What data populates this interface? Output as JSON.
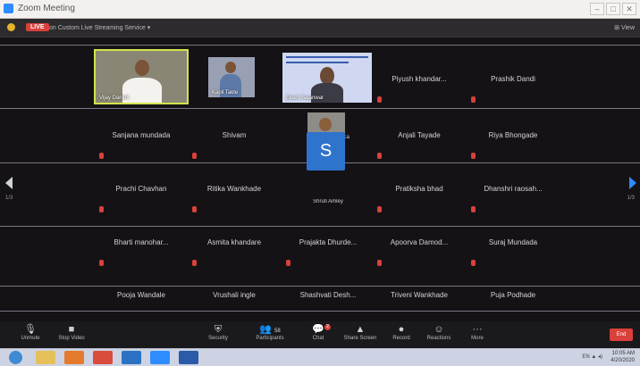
{
  "window": {
    "title": "Zoom Meeting",
    "controls": [
      "–",
      "□",
      "✕"
    ]
  },
  "meeting_bar": {
    "live_label": "LIVE",
    "topic": "on Custom Live Streaming Service ▾",
    "view_label": "⊞ View"
  },
  "rows": [
    [
      {
        "name": "Vijay Dankhl",
        "video": true
      },
      {
        "name": "Kapil Takte",
        "video": true
      },
      {
        "name": "Ekant Sajanwar",
        "video": true
      },
      {
        "name": "Piyush  khandar..."
      },
      {
        "name": "Prashik Dandi"
      }
    ],
    [
      {
        "name": "Sanjana mundada"
      },
      {
        "name": "Shivam"
      },
      {
        "name": "Crishnadhurati Ka",
        "video": true
      },
      {
        "name": "Anjali Tayade"
      },
      {
        "name": "Riya Bhongade"
      }
    ],
    [
      {
        "name": "Prachi Chavhan"
      },
      {
        "name": "Ritika Wankhade"
      },
      {
        "name": "Shruti Amley",
        "avatar": "S"
      },
      {
        "name": "Pratiksha bhad"
      },
      {
        "name": "Dhanshri  raosah..."
      }
    ],
    [
      {
        "name": "Bharti  manohar..."
      },
      {
        "name": "Asmita khandare"
      },
      {
        "name": "Prajakta  Dhurde..."
      },
      {
        "name": "Apoorva  Damod..."
      },
      {
        "name": "Suraj Mundada"
      }
    ],
    [
      {
        "name": "Pooja Wandale"
      },
      {
        "name": "Vrushali ingle"
      },
      {
        "name": "Shashvati  Desh..."
      },
      {
        "name": "Triveni Wankhade"
      },
      {
        "name": "Puja Podhade"
      }
    ]
  ],
  "pager": {
    "left": "1/3",
    "right": "1/3"
  },
  "toolbar": {
    "unmute": "Unmute",
    "stop_video": "Stop Video",
    "security": "Security",
    "participants": "Participants",
    "participants_count": "58",
    "chat": "Chat",
    "chat_badge": "2",
    "share_screen": "Share Screen",
    "record": "Record",
    "reactions": "Reactions",
    "more": "More",
    "end": "End"
  },
  "taskbar": {
    "time": "10:05 AM",
    "date": "4/20/2020",
    "tray": "EN  ▲  ◂)"
  },
  "colors": {
    "accent": "#2d8cff",
    "live": "#d9413a",
    "active_speaker": "#d4e34a"
  }
}
